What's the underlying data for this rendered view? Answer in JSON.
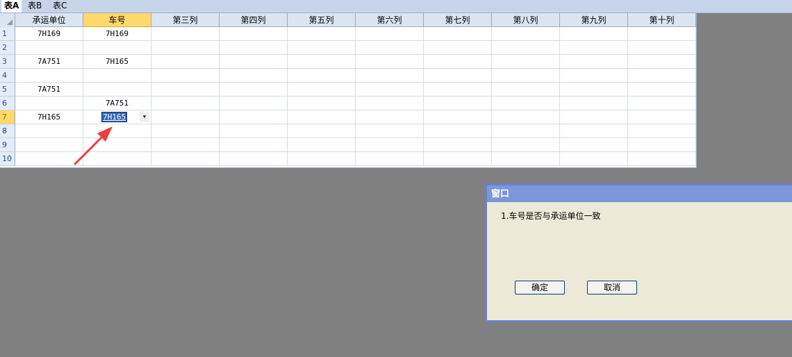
{
  "tabs": [
    "表A",
    "表B",
    "表C"
  ],
  "active_tab": 0,
  "columns": [
    "承运单位",
    "车号",
    "第三列",
    "第四列",
    "第五列",
    "第六列",
    "第七列",
    "第八列",
    "第九列",
    "第十列"
  ],
  "selected_column": 1,
  "selected_row": 7,
  "rows": [
    {
      "num": "1",
      "c1": "7H169",
      "c2": "7H169"
    },
    {
      "num": "2",
      "c1": "",
      "c2": ""
    },
    {
      "num": "3",
      "c1": "7A751",
      "c2": "7H165"
    },
    {
      "num": "4",
      "c1": "",
      "c2": ""
    },
    {
      "num": "5",
      "c1": "7A751",
      "c2": ""
    },
    {
      "num": "6",
      "c1": "",
      "c2": "7A751"
    },
    {
      "num": "7",
      "c1": "7H165",
      "c2": "7H165"
    },
    {
      "num": "8",
      "c1": "",
      "c2": ""
    },
    {
      "num": "9",
      "c1": "",
      "c2": ""
    },
    {
      "num": "10",
      "c1": "",
      "c2": ""
    }
  ],
  "editor": {
    "value": "7H165",
    "dropdown_glyph": "▼"
  },
  "dialog": {
    "title": "窗口",
    "message": "1.车号是否与承运单位一致",
    "ok_label": "确定",
    "cancel_label": "取消"
  },
  "colors": {
    "accent": "#ffd96a",
    "header": "#dbe5f1",
    "arrow": "#f03c3c",
    "dialog_title": "#7d96d8"
  }
}
